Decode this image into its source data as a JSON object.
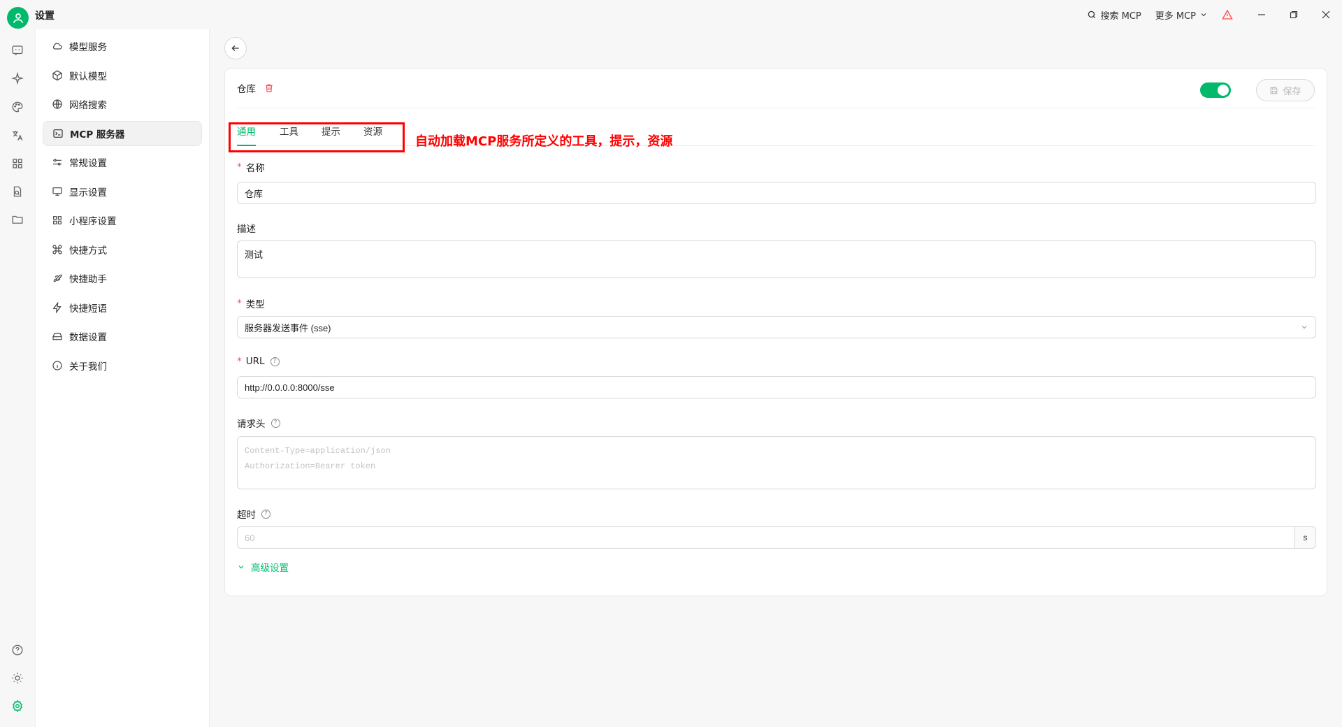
{
  "window": {
    "title": "设置",
    "search_mcp": "搜索 MCP",
    "more_mcp": "更多 MCP"
  },
  "sidebar": {
    "items": [
      {
        "label": "模型服务",
        "icon": "cloud-icon"
      },
      {
        "label": "默认模型",
        "icon": "cube-icon"
      },
      {
        "label": "网络搜索",
        "icon": "globe-icon"
      },
      {
        "label": "MCP 服务器",
        "icon": "terminal-icon",
        "active": true
      },
      {
        "label": "常规设置",
        "icon": "sliders-icon"
      },
      {
        "label": "显示设置",
        "icon": "monitor-icon"
      },
      {
        "label": "小程序设置",
        "icon": "grid-icon"
      },
      {
        "label": "快捷方式",
        "icon": "command-icon"
      },
      {
        "label": "快捷助手",
        "icon": "rocket-icon"
      },
      {
        "label": "快捷短语",
        "icon": "bolt-icon"
      },
      {
        "label": "数据设置",
        "icon": "hard-drive-icon"
      },
      {
        "label": "关于我们",
        "icon": "info-icon"
      }
    ]
  },
  "server": {
    "name": "仓库",
    "enabled": true,
    "save_label": "保存"
  },
  "tabs": [
    "通用",
    "工具",
    "提示",
    "资源"
  ],
  "annotation": "自动加载MCP服务所定义的工具，提示，资源",
  "form": {
    "name_label": "名称",
    "name_value": "仓库",
    "desc_label": "描述",
    "desc_value": "测试",
    "type_label": "类型",
    "type_value": "服务器发送事件 (sse)",
    "url_label": "URL",
    "url_value": "http://0.0.0.0:8000/sse",
    "headers_label": "请求头",
    "headers_placeholder_1": "Content-Type=application/json",
    "headers_placeholder_2": "Authorization=Bearer token",
    "timeout_label": "超时",
    "timeout_placeholder": "60",
    "timeout_unit": "s",
    "advanced_label": "高级设置"
  },
  "colors": {
    "accent": "#00b96b",
    "annotation": "#ff0000",
    "danger": "#ff4d4f"
  }
}
